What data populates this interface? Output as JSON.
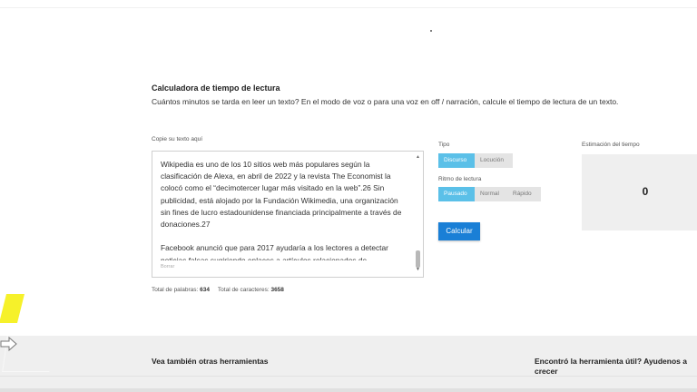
{
  "tool": {
    "title": "Calculadora de tiempo de lectura",
    "description": "Cuántos minutos se tarda en leer un texto? En el modo de voz o para una voz en off / narración, calcule el tiempo de lectura de un texto."
  },
  "input": {
    "label": "Copie su texto aquí",
    "text": "Wikipedia es uno de los 10 sitios web más populares según la clasificación de Alexa, en abril de 2022 y la revista The Economist la colocó como el “decimotercer lugar más visitado en la web”.26 Sin publicidad, está alojado por la Fundación Wikimedia, una organización sin fines de lucro estadounidense financiada principalmente a través de donaciones.27\n\nFacebook anunció que para 2017 ayudaría a los lectores a detectar noticias falsas sugiriendo enlaces a artículos relacionados de",
    "clear_label": "Borrar"
  },
  "counts": {
    "words_label": "Total de palabras:",
    "words_value": "634",
    "chars_label": "Total de caracteres:",
    "chars_value": "3658"
  },
  "options": {
    "tipo_label": "Tipo",
    "tipo_options": [
      "Discurso",
      "Locución"
    ],
    "tipo_selected": "Discurso",
    "ritmo_label": "Ritmo de lectura",
    "ritmo_options": [
      "Pausado",
      "Normal",
      "Rápido"
    ],
    "ritmo_selected": "Pausado",
    "calculate_label": "Calcular"
  },
  "estimate": {
    "label": "Estimación del tiempo",
    "value": "0"
  },
  "footer": {
    "see_also": "Vea también otras herramientas",
    "helpful": "Encontró la herramienta útil? Ayudenos a crecer"
  },
  "colors": {
    "accent": "#5bc0e8",
    "button": "#1a7fd6",
    "highlighter": "#f6f12a"
  },
  "icons": {
    "cursor": "arrow-cursor-icon"
  }
}
